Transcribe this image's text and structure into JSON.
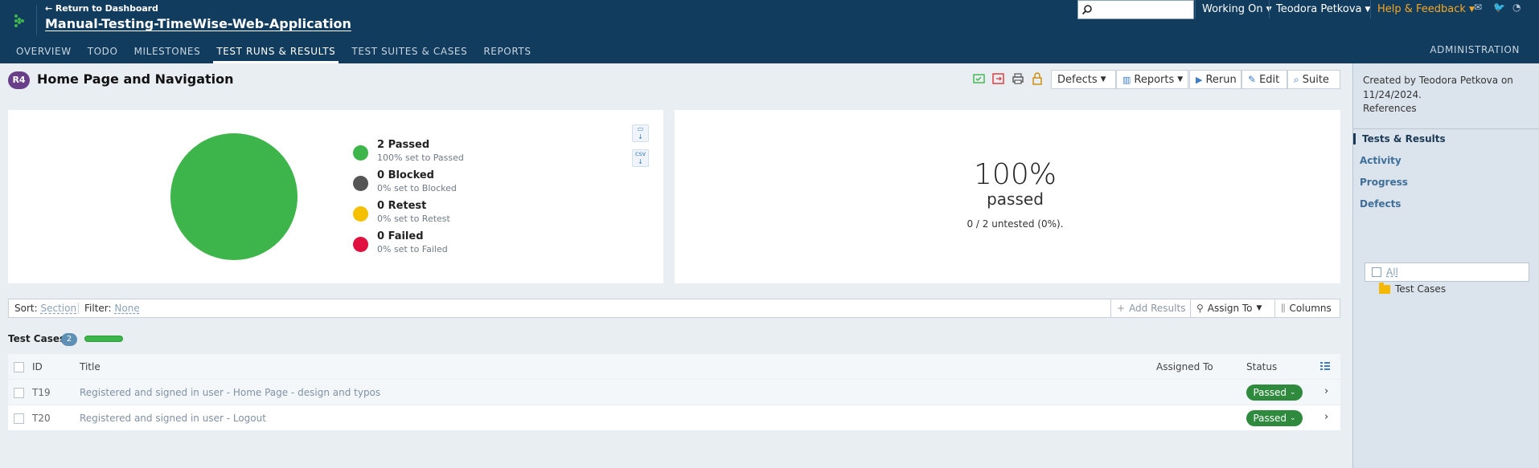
{
  "header": {
    "back_link": "← Return to Dashboard",
    "project_name": "Manual-Testing-TimeWise-Web-Application",
    "search_placeholder": "",
    "working_on": "Working On",
    "user_name": "Teodora Petkova",
    "help": "Help & Feedback"
  },
  "nav": {
    "tabs": [
      {
        "label": "OVERVIEW"
      },
      {
        "label": "TODO"
      },
      {
        "label": "MILESTONES"
      },
      {
        "label": "TEST RUNS & RESULTS"
      },
      {
        "label": "TEST SUITES & CASES"
      },
      {
        "label": "REPORTS"
      }
    ],
    "admin": "ADMINISTRATION"
  },
  "run": {
    "badge": "R4",
    "title": "Home Page and Navigation"
  },
  "toolbar": {
    "defects": "Defects",
    "reports": "Reports",
    "rerun": "Rerun",
    "edit": "Edit",
    "suite": "Suite"
  },
  "legend": [
    {
      "label": "2 Passed",
      "sub": "100% set to Passed",
      "color": "#3db54a"
    },
    {
      "label": "0 Blocked",
      "sub": "0% set to Blocked",
      "color": "#555555"
    },
    {
      "label": "0 Retest",
      "sub": "0% set to Retest",
      "color": "#f5c000"
    },
    {
      "label": "0 Failed",
      "sub": "0% set to Failed",
      "color": "#e0103f"
    }
  ],
  "chart_data": {
    "type": "pie",
    "categories": [
      "Passed",
      "Blocked",
      "Retest",
      "Failed"
    ],
    "values": [
      2,
      0,
      0,
      0
    ]
  },
  "summary": {
    "percent": "100%",
    "label": "passed",
    "sub": "0 / 2 untested (0%)."
  },
  "filterbar": {
    "sort_label": "Sort:",
    "sort_value": "Section",
    "filter_label": "Filter:",
    "filter_value": "None",
    "add_results": "Add Results",
    "assign_to": "Assign To",
    "columns": "Columns"
  },
  "test_cases": {
    "title": "Test Cases",
    "count": "2",
    "headers": {
      "id": "ID",
      "title": "Title",
      "assigned": "Assigned To",
      "status": "Status"
    },
    "rows": [
      {
        "id": "T19",
        "title": "Registered and signed in user - Home Page - design and typos",
        "status": "Passed"
      },
      {
        "id": "T20",
        "title": "Registered and signed in user - Logout",
        "status": "Passed"
      }
    ]
  },
  "sidebar": {
    "created": "Created by Teodora Petkova on 11/24/2024.",
    "references": "References",
    "items": [
      {
        "label": "Tests & Results"
      },
      {
        "label": "Activity"
      },
      {
        "label": "Progress"
      },
      {
        "label": "Defects"
      }
    ],
    "filter_value": "All",
    "folder": "Test Cases"
  }
}
